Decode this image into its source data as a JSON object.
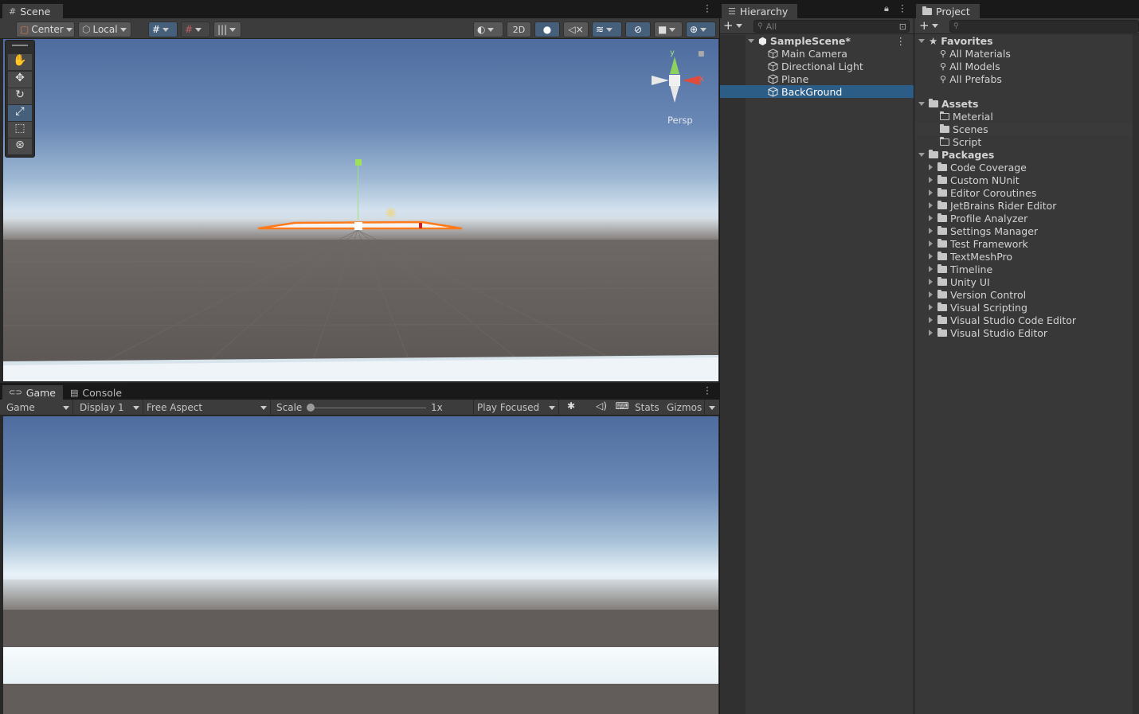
{
  "scene": {
    "tab": "Scene",
    "toolbar": {
      "pivot": "Center",
      "space": "Local",
      "mode_2d": "2D"
    },
    "gizmo": {
      "y": "y",
      "x": "x",
      "persp": "Persp"
    }
  },
  "game": {
    "tabs": [
      "Game",
      "Console"
    ],
    "toolbar": {
      "view": "Game",
      "display": "Display 1",
      "aspect": "Free Aspect",
      "scale_label": "Scale",
      "scale_value": "1x",
      "play_mode": "Play Focused",
      "stats": "Stats",
      "gizmos": "Gizmos"
    }
  },
  "hierarchy": {
    "tab": "Hierarchy",
    "search_placeholder": "All",
    "scene": "SampleScene*",
    "items": [
      "Main Camera",
      "Directional Light",
      "Plane",
      "BackGround"
    ],
    "selected": "BackGround"
  },
  "project": {
    "tab": "Project",
    "favorites": {
      "label": "Favorites",
      "items": [
        "All Materials",
        "All Models",
        "All Prefabs"
      ]
    },
    "assets": {
      "label": "Assets",
      "items": [
        "Meterial",
        "Scenes",
        "Script"
      ]
    },
    "packages": {
      "label": "Packages",
      "items": [
        "Code Coverage",
        "Custom NUnit",
        "Editor Coroutines",
        "JetBrains Rider Editor",
        "Profile Analyzer",
        "Settings Manager",
        "Test Framework",
        "TextMeshPro",
        "Timeline",
        "Unity UI",
        "Version Control",
        "Visual Scripting",
        "Visual Studio Code Editor",
        "Visual Studio Editor"
      ]
    }
  },
  "colors": {
    "selection": "#2c5d87",
    "panel": "#383838",
    "toolbar": "#3c3c3c",
    "accent_orange": "#ff7a1a"
  }
}
